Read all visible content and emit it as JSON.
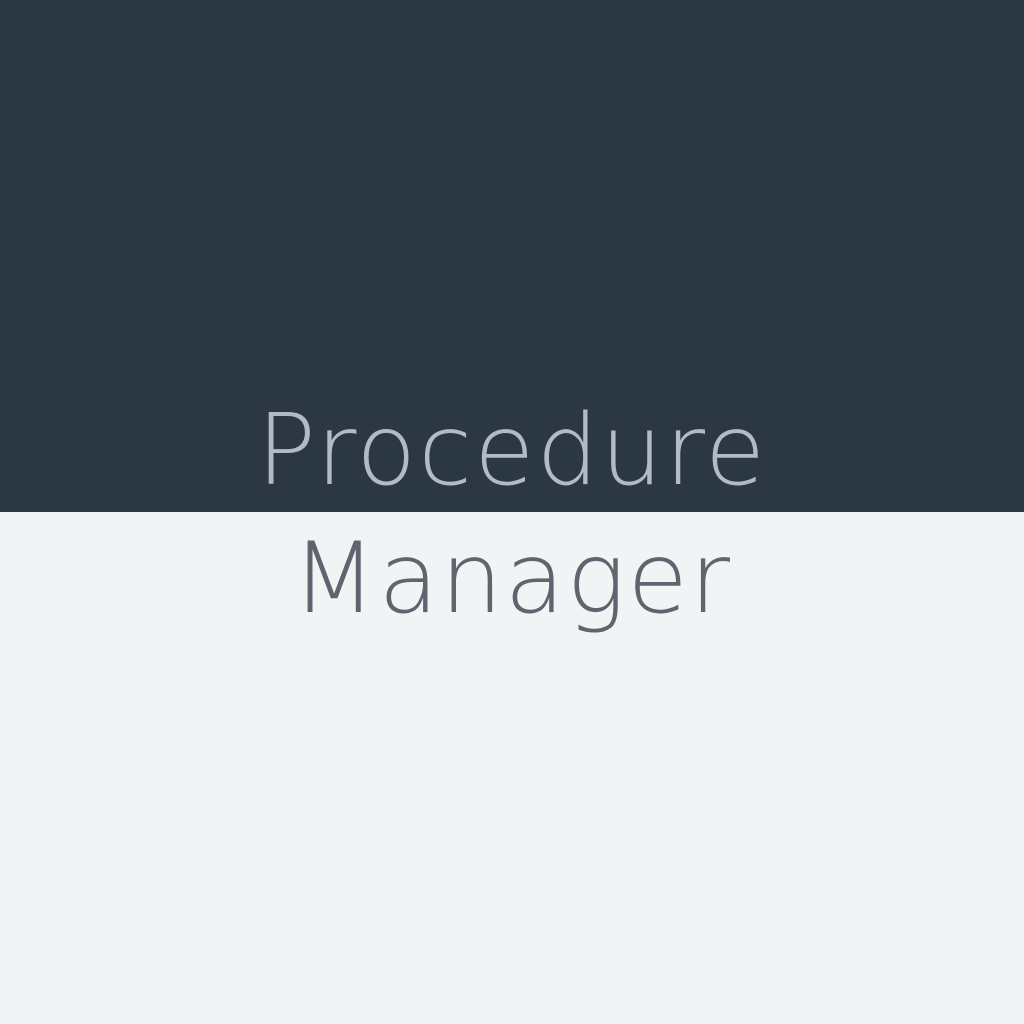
{
  "splash": {
    "title_line_1": "Procedure",
    "title_line_2": "Manager"
  },
  "colors": {
    "top_background": "#2c3744",
    "bottom_background": "#f2f3f5",
    "title_line_1_text": "#b3b9c7",
    "title_line_2_text": "#61636e"
  }
}
